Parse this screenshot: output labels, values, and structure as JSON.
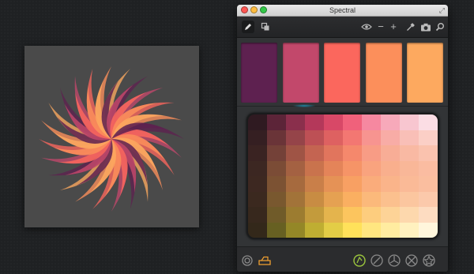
{
  "window": {
    "title": "Spectral"
  },
  "toolbar": {
    "left_tools": [
      "pencil-icon",
      "layers-icon"
    ],
    "right_tools": [
      "eye-icon",
      "minus-icon",
      "plus-icon",
      "eyedropper-icon",
      "camera-icon",
      "search-icon"
    ],
    "minus_label": "−",
    "plus_label": "+"
  },
  "palette": {
    "swatches": [
      "#5e2150",
      "#c2486b",
      "#fb675d",
      "#fc8f5b",
      "#fda95f"
    ]
  },
  "grid": {
    "rows": 8,
    "cols": 10,
    "top_row": [
      "#361a2a",
      "#5c2438",
      "#8a2f4c",
      "#b4385a",
      "#d84867",
      "#f0617b",
      "#f688a0",
      "#f7a9ba",
      "#f8c6d0",
      "#fbdde4"
    ],
    "bottom_row": [
      "#3d3a1a",
      "#676022",
      "#948727",
      "#bfae32",
      "#e3cd46",
      "#ffe15a",
      "#ffe680",
      "#ffeca0",
      "#fff1bf",
      "#fff6dc"
    ],
    "dark_corner": "#2a1a1a"
  },
  "bottom_bar": {
    "left_tools": [
      "color-wheel-icon",
      "palette-tray-icon"
    ],
    "right_tools": [
      "harmony-analogous-icon",
      "harmony-line-icon",
      "harmony-triad-icon",
      "harmony-square-icon",
      "harmony-star-icon"
    ],
    "active_accent": "#9bc53d",
    "tray_accent": "#f0a030"
  },
  "artwork": {
    "background": "#4a4a4a",
    "petal_colors": [
      "#5e2150",
      "#c2486b",
      "#fb675d",
      "#fc8f5b",
      "#fda95f"
    ]
  }
}
